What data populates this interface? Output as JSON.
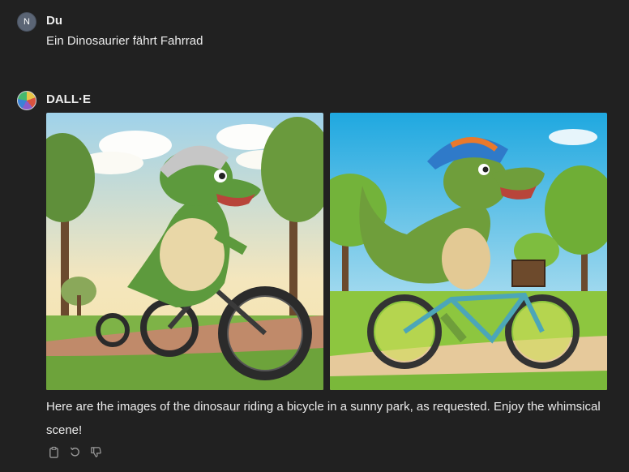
{
  "user_message": {
    "avatar_initial": "N",
    "author": "Du",
    "text": "Ein Dinosaurier fährt Fahrrad"
  },
  "assistant_message": {
    "avatar_icon": "dalle-logo-icon",
    "author": "DALL·E",
    "images": [
      {
        "subject": "generated-image-dinosaur-training-wheels"
      },
      {
        "subject": "generated-image-dinosaur-basket-bike"
      }
    ],
    "text": "Here are the images of the dinosaur riding a bicycle in a sunny park, as requested. Enjoy the whimsical scene!",
    "actions": [
      {
        "icon": "copy-icon"
      },
      {
        "icon": "regenerate-icon"
      },
      {
        "icon": "thumbs-down-icon"
      }
    ]
  },
  "colors": {
    "background": "#212121",
    "text": "#ececec",
    "muted_icon": "#9b9b9b"
  }
}
